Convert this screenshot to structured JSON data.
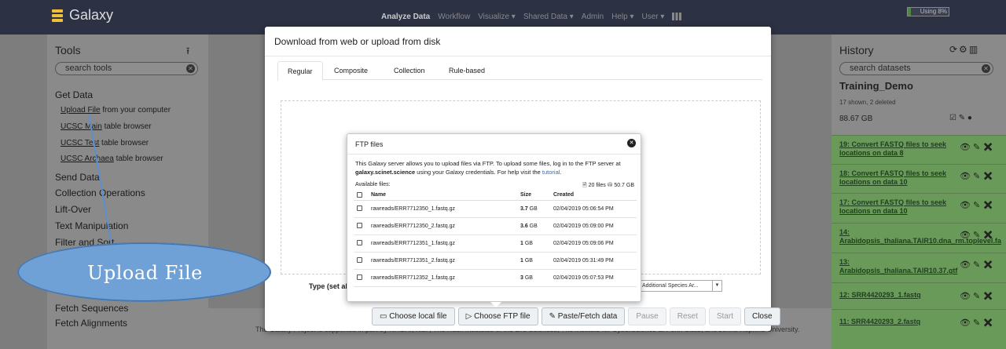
{
  "masthead": {
    "brand": "Galaxy",
    "nav": [
      "Analyze Data",
      "Workflow",
      "Visualize ▾",
      "Shared Data ▾",
      "Admin",
      "Help ▾",
      "User ▾"
    ],
    "quota_label": "Using 8%",
    "quota_fraction": 0.08
  },
  "tools": {
    "title": "Tools",
    "search_placeholder": "search tools",
    "sections": [
      {
        "label": "Get Data",
        "tools": [
          {
            "link": "Upload File",
            "rest": " from your computer"
          },
          {
            "link": "UCSC Main",
            "rest": " table browser"
          },
          {
            "link": "UCSC Test",
            "rest": " table browser"
          },
          {
            "link": "UCSC Archaea",
            "rest": " table browser"
          }
        ]
      },
      {
        "label": "Send Data"
      },
      {
        "label": "Collection Operations"
      },
      {
        "label": "Lift-Over"
      },
      {
        "label": "Text Manipulation"
      },
      {
        "label": "Filter and Sort"
      },
      {
        "label": "Fetch Sequences"
      },
      {
        "label": "Fetch Alignments"
      }
    ]
  },
  "center": {
    "footer_text": "The Galaxy Project is supported in part by NHGRI, NSF, The Huck Institutes of the Life Sciences, The Institute for CyberScience at Penn State, and Johns Hopkins University."
  },
  "history": {
    "title": "History",
    "search_placeholder": "search datasets",
    "name": "Training_Demo",
    "shown": "17 shown, 2 deleted",
    "size": "88.67 GB",
    "datasets": [
      {
        "title": "19: Convert FASTQ files to seek locations on data 8"
      },
      {
        "title": "18: Convert FASTQ files to seek locations on data 10"
      },
      {
        "title": "17: Convert FASTQ files to seek locations on data 10"
      },
      {
        "title": "14: Arabidopsis_thaliana.TAIR10.dna_rm.toplevel.fa"
      },
      {
        "title": "13: Arabidopsis_thaliana.TAIR10.37.gtf"
      },
      {
        "title": "12: SRR4420293_1.fastq"
      },
      {
        "title": "11: SRR4420293_2.fastq"
      }
    ]
  },
  "modal": {
    "title": "Download from web or upload from disk",
    "tabs": [
      "Regular",
      "Composite",
      "Collection",
      "Rule-based"
    ],
    "type_label": "Type (set all):",
    "genome_value": "Additional Species Ar...",
    "buttons": {
      "local": "Choose local file",
      "ftp": "Choose FTP file",
      "paste": "Paste/Fetch data",
      "pause": "Pause",
      "reset": "Reset",
      "start": "Start",
      "close": "Close"
    }
  },
  "ftp": {
    "title": "FTP files",
    "desc_1": "This Galaxy server allows you to upload files via FTP. To upload some files, log in to the FTP server at ",
    "server": "galaxy.scinet.science",
    "desc_2": " using your Galaxy credentials. For help visit the ",
    "tutorial": "tutorial",
    "available": "Available files:",
    "total": "20 files",
    "total_size": "50.7 GB",
    "columns": [
      "Name",
      "Size",
      "Created"
    ],
    "files": [
      {
        "name": "rawreads/ERR7712350_1.fastq.gz",
        "size_num": "3.7",
        "size_unit": " GB",
        "created": "02/04/2019 05:06:54 PM"
      },
      {
        "name": "rawreads/ERR7712350_2.fastq.gz",
        "size_num": "3.6",
        "size_unit": " GB",
        "created": "02/04/2019 05:09:00 PM"
      },
      {
        "name": "rawreads/ERR7712351_1.fastq.gz",
        "size_num": "1",
        "size_unit": " GB",
        "created": "02/04/2019 05:09:06 PM"
      },
      {
        "name": "rawreads/ERR7712351_2.fastq.gz",
        "size_num": "1",
        "size_unit": " GB",
        "created": "02/04/2019 05:31:49 PM"
      },
      {
        "name": "rawreads/ERR7712352_1.fastq.gz",
        "size_num": "3",
        "size_unit": " GB",
        "created": "02/04/2019 05:07:53 PM"
      }
    ]
  },
  "annotation": {
    "label": "Upload File"
  }
}
